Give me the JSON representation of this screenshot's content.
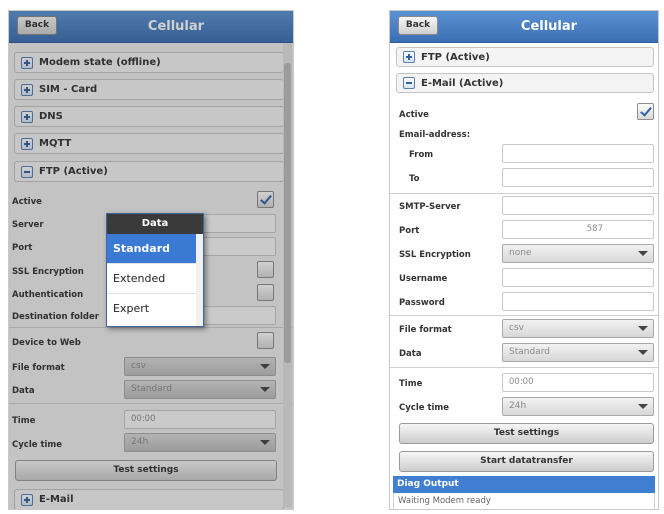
{
  "left": {
    "back": "Back",
    "title": "Cellular",
    "sections": {
      "modem": "Modem state (offline)",
      "sim": "SIM - Card",
      "dns": "DNS",
      "mqtt": "MQTT",
      "ftp": "FTP (Active)",
      "email": "E-Mail"
    },
    "labels": {
      "active": "Active",
      "server": "Server",
      "port": "Port",
      "ssl": "SSL Encryption",
      "auth": "Authentication",
      "dest": "Destination folder",
      "device_web": "Device to Web",
      "file_format": "File format",
      "data": "Data",
      "time": "Time",
      "cycle": "Cycle time"
    },
    "values": {
      "file_format": "csv",
      "data": "Standard",
      "time": "00:00",
      "cycle": "24h"
    },
    "test_button": "Test settings",
    "popup": {
      "title": "Data",
      "options": [
        "Standard",
        "Extended",
        "Expert"
      ],
      "selected": "Standard"
    }
  },
  "right": {
    "back": "Back",
    "title": "Cellular",
    "sections": {
      "ftp": "FTP (Active)",
      "email": "E-Mail (Active)"
    },
    "labels": {
      "active": "Active",
      "email_address": "Email-address:",
      "from": "From",
      "to": "To",
      "smtp": "SMTP-Server",
      "port": "Port",
      "ssl": "SSL Encryption",
      "username": "Username",
      "password": "Password",
      "file_format": "File format",
      "data": "Data",
      "time": "Time",
      "cycle": "Cycle time"
    },
    "values": {
      "port": "587",
      "ssl": "none",
      "file_format": "csv",
      "data": "Standard",
      "time": "00:00",
      "cycle": "24h"
    },
    "test_button": "Test settings",
    "start_button": "Start datatransfer",
    "diag": {
      "title": "Diag Output",
      "message": "Waiting Modem ready"
    }
  }
}
